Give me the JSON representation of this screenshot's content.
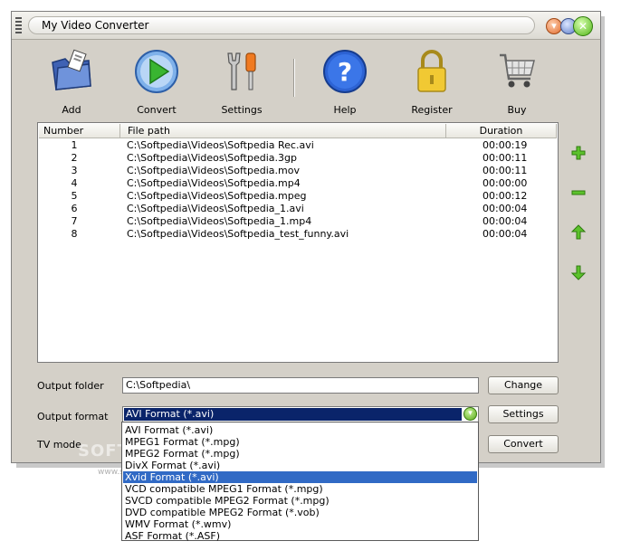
{
  "window": {
    "title": "My Video Converter"
  },
  "toolbar": {
    "add": "Add",
    "convert": "Convert",
    "settings": "Settings",
    "help": "Help",
    "register": "Register",
    "buy": "Buy"
  },
  "list": {
    "columns": [
      "Number",
      "File path",
      "Duration"
    ],
    "rows": [
      {
        "number": "1",
        "path": "C:\\Softpedia\\Videos\\Softpedia Rec.avi",
        "duration": "00:00:19"
      },
      {
        "number": "2",
        "path": "C:\\Softpedia\\Videos\\Softpedia.3gp",
        "duration": "00:00:11"
      },
      {
        "number": "3",
        "path": "C:\\Softpedia\\Videos\\Softpedia.mov",
        "duration": "00:00:11"
      },
      {
        "number": "4",
        "path": "C:\\Softpedia\\Videos\\Softpedia.mp4",
        "duration": "00:00:00"
      },
      {
        "number": "5",
        "path": "C:\\Softpedia\\Videos\\Softpedia.mpeg",
        "duration": "00:00:12"
      },
      {
        "number": "6",
        "path": "C:\\Softpedia\\Videos\\Softpedia_1.avi",
        "duration": "00:00:04"
      },
      {
        "number": "7",
        "path": "C:\\Softpedia\\Videos\\Softpedia_1.mp4",
        "duration": "00:00:04"
      },
      {
        "number": "8",
        "path": "C:\\Softpedia\\Videos\\Softpedia_test_funny.avi",
        "duration": "00:00:04"
      }
    ]
  },
  "side_buttons": [
    "add-icon",
    "remove-icon",
    "move-up-icon",
    "move-down-icon"
  ],
  "form": {
    "output_folder_label": "Output folder",
    "output_folder_value": "C:\\Softpedia\\",
    "change_button": "Change",
    "output_format_label": "Output format",
    "output_format_value": "AVI Format (*.avi)",
    "settings_button": "Settings",
    "tv_mode_label": "TV mode",
    "convert_button": "Convert"
  },
  "format_options": [
    "AVI Format (*.avi)",
    "MPEG1 Format (*.mpg)",
    "MPEG2 Format (*.mpg)",
    "DivX Format (*.avi)",
    "Xvid Format (*.avi)",
    "VCD compatible MPEG1 Format (*.mpg)",
    "SVCD compatible MPEG2 Format (*.mpg)",
    "DVD compatible MPEG2 Format (*.vob)",
    "WMV Format (*.wmv)",
    "ASF Format (*.ASF)"
  ],
  "highlighted_option": "Xvid Format (*.avi)",
  "watermark": {
    "text": "SOFT",
    "url": "www.softp"
  },
  "colors": {
    "accent_green": "#4fb415",
    "selection_blue": "#316ac5",
    "combo_selection": "#0a246a"
  }
}
